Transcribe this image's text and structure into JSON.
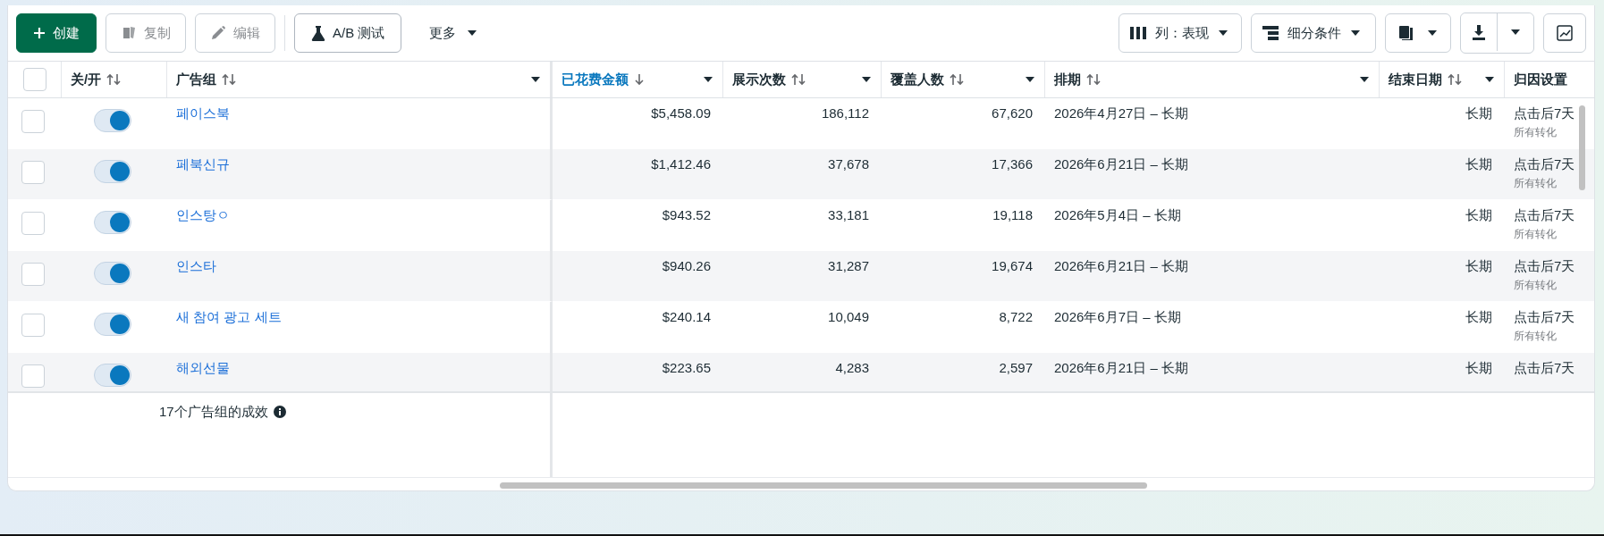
{
  "toolbar": {
    "left": [
      {
        "kind": "create",
        "label": "创建",
        "disabled": false
      },
      {
        "kind": "copy",
        "label": "复制",
        "disabled": true
      },
      {
        "kind": "edit",
        "label": "编辑",
        "disabled": true
      },
      {
        "kind": "test",
        "label": "A/B 测试",
        "disabled": false
      },
      {
        "kind": "more",
        "label": "更多",
        "disabled": false
      }
    ],
    "right": [
      {
        "kind": "columns",
        "label": "列：表现"
      },
      {
        "kind": "breakdown",
        "label": "细分条件"
      },
      {
        "kind": "reports"
      },
      {
        "kind": "export"
      },
      {
        "kind": "chart"
      }
    ]
  },
  "table": {
    "select_all": {
      "checked": false
    },
    "columns": [
      {
        "label": "关/开",
        "sortable": true,
        "sorted": false,
        "menu": false
      },
      {
        "label": "广告组",
        "sortable": true,
        "sorted": false,
        "menu": true
      },
      {
        "label": "已花费金额",
        "sortable": true,
        "sorted": true,
        "menu": true
      },
      {
        "label": "展示次数",
        "sortable": true,
        "sorted": false,
        "menu": true
      },
      {
        "label": "覆盖人数",
        "sortable": true,
        "sorted": false,
        "menu": true
      },
      {
        "label": "排期",
        "sortable": true,
        "sorted": false,
        "menu": true
      },
      {
        "label": "结束日期",
        "sortable": true,
        "sorted": false,
        "menu": true
      },
      {
        "label": "归因设置",
        "sortable": false,
        "sorted": false,
        "menu": false
      }
    ],
    "rows": [
      {
        "checked": false,
        "on": true,
        "name": "페이스북",
        "spent": "$5,458.09",
        "impressions": "186,112",
        "reach": "67,620",
        "schedule": "2026年4月27日 – 长期",
        "end": "长期",
        "attribution": "点击后7天",
        "attribution_note": "所有转化"
      },
      {
        "checked": false,
        "on": true,
        "name": "페북신규",
        "spent": "$1,412.46",
        "impressions": "37,678",
        "reach": "17,366",
        "schedule": "2026年6月21日 – 长期",
        "end": "长期",
        "attribution": "点击后7天",
        "attribution_note": "所有转化"
      },
      {
        "checked": false,
        "on": true,
        "name": "인스탕ㅇ",
        "spent": "$943.52",
        "impressions": "33,181",
        "reach": "19,118",
        "schedule": "2026年5月4日 – 长期",
        "end": "长期",
        "attribution": "点击后7天",
        "attribution_note": "所有转化"
      },
      {
        "checked": false,
        "on": true,
        "name": "인스타",
        "spent": "$940.26",
        "impressions": "31,287",
        "reach": "19,674",
        "schedule": "2026年6月21日 – 长期",
        "end": "长期",
        "attribution": "点击后7天",
        "attribution_note": "所有转化"
      },
      {
        "checked": false,
        "on": true,
        "name": "새 참여 광고 세트",
        "spent": "$240.14",
        "impressions": "10,049",
        "reach": "8,722",
        "schedule": "2026年6月7日 – 长期",
        "end": "长期",
        "attribution": "点击后7天",
        "attribution_note": "所有转化"
      },
      {
        "checked": false,
        "on": true,
        "name": "해외선물",
        "spent": "$223.65",
        "impressions": "4,283",
        "reach": "2,597",
        "schedule": "2026年6月21日 – 长期",
        "end": "长期",
        "attribution": "点击后7天"
      }
    ],
    "summary": "17个广告组的成效"
  }
}
